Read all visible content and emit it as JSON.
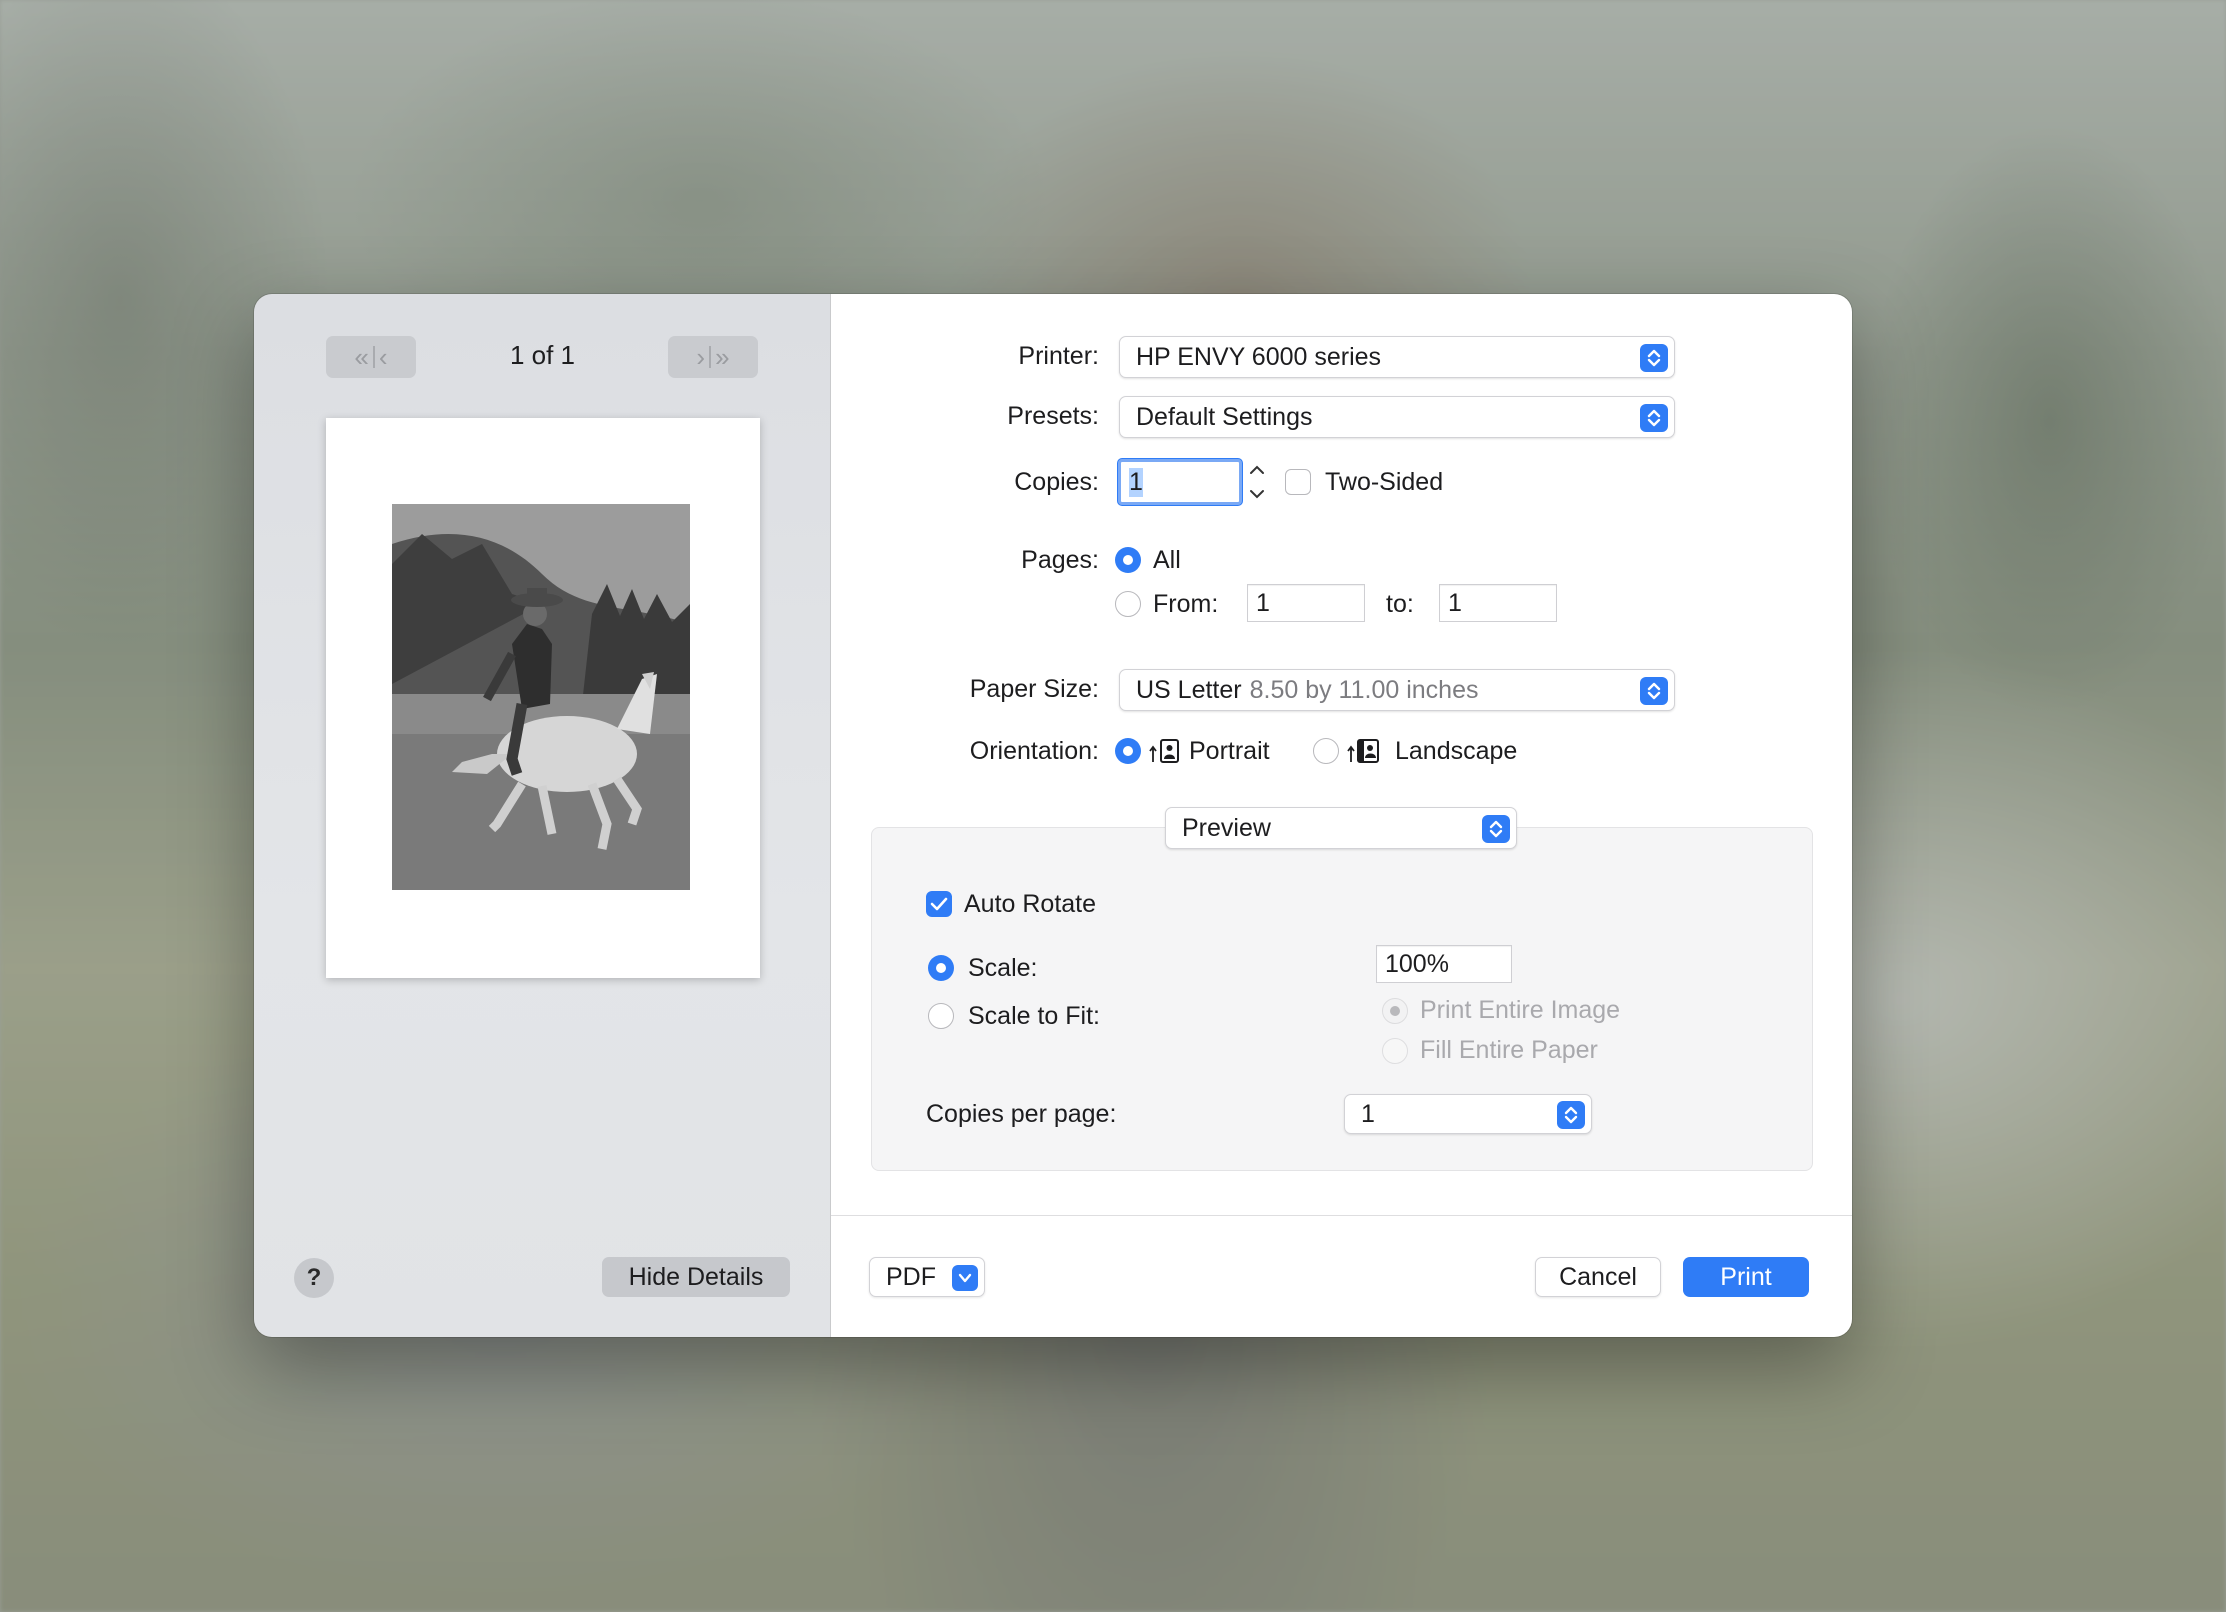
{
  "navigation": {
    "page_counter": "1 of 1",
    "first_page_label": "«",
    "prev_page_label": "‹",
    "next_page_label": "›",
    "last_page_label": "»"
  },
  "left_footer": {
    "help_label": "?",
    "hide_details_label": "Hide Details"
  },
  "printer": {
    "label": "Printer:",
    "value": "HP ENVY 6000 series"
  },
  "presets": {
    "label": "Presets:",
    "value": "Default Settings"
  },
  "copies": {
    "label": "Copies:",
    "value": "1",
    "two_sided_label": "Two-Sided",
    "two_sided_checked": false
  },
  "pages": {
    "label": "Pages:",
    "all_label": "All",
    "from_label": "From:",
    "from_value": "1",
    "to_label": "to:",
    "to_value": "1",
    "selected": "All"
  },
  "paper_size": {
    "label": "Paper Size:",
    "value": "US Letter",
    "detail": "8.50 by 11.00 inches"
  },
  "orientation": {
    "label": "Orientation:",
    "portrait_label": "Portrait",
    "landscape_label": "Landscape",
    "selected": "Portrait"
  },
  "app_section": {
    "selected": "Preview",
    "auto_rotate_label": "Auto Rotate",
    "auto_rotate_checked": true,
    "scale_label": "Scale:",
    "scale_value": "100%",
    "scale_to_fit_label": "Scale to Fit:",
    "print_entire_image_label": "Print Entire Image",
    "fill_entire_paper_label": "Fill Entire Paper",
    "copies_per_page_label": "Copies per page:",
    "copies_per_page_value": "1"
  },
  "footer": {
    "pdf_label": "PDF",
    "cancel_label": "Cancel",
    "print_label": "Print"
  },
  "colors": {
    "accent": "#2f7cf6",
    "dialog_bg": "#ffffff",
    "sidebar_bg": "#e1e3e6"
  }
}
